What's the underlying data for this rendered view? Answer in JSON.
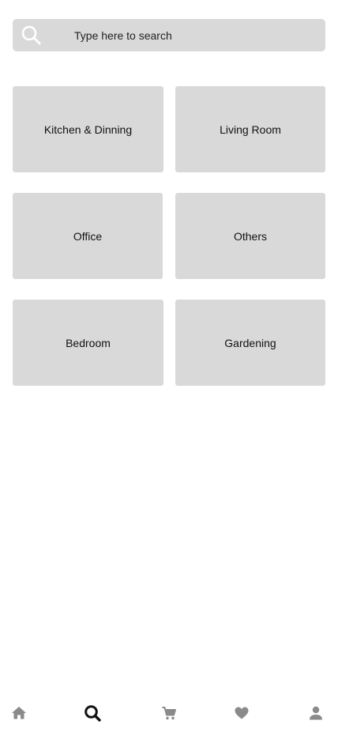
{
  "search": {
    "placeholder": "Type here to search",
    "icon": "search-icon"
  },
  "categories": [
    {
      "label": "Kitchen & Dinning"
    },
    {
      "label": "Living Room"
    },
    {
      "label": "Office"
    },
    {
      "label": "Others"
    },
    {
      "label": "Bedroom"
    },
    {
      "label": "Gardening"
    }
  ],
  "bottom_nav": {
    "active": "search",
    "items": [
      {
        "id": "home",
        "icon": "home-icon"
      },
      {
        "id": "search",
        "icon": "search-icon"
      },
      {
        "id": "cart",
        "icon": "cart-icon"
      },
      {
        "id": "favorites",
        "icon": "heart-icon"
      },
      {
        "id": "profile",
        "icon": "person-icon"
      }
    ]
  },
  "colors": {
    "surface": "#d9d9d9",
    "icon_inactive": "#8a8a8a",
    "icon_active": "#111111",
    "search_icon": "#ffffff"
  }
}
